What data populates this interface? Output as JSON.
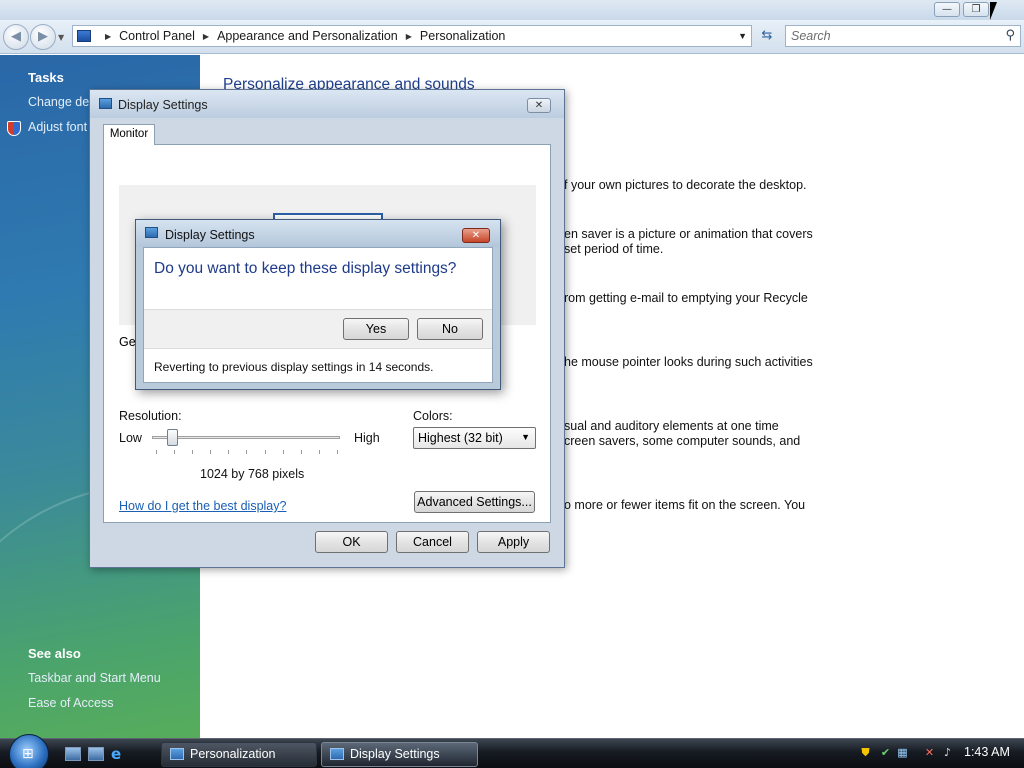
{
  "explorer": {
    "breadcrumb": [
      "Control Panel",
      "Appearance and Personalization",
      "Personalization"
    ],
    "search_placeholder": "Search",
    "back_icon": "back-arrow-icon",
    "forward_icon": "forward-arrow-icon"
  },
  "left_pane": {
    "tasks_heading": "Tasks",
    "task_links": [
      "Change des",
      "Adjust font"
    ],
    "see_also_heading": "See also",
    "see_also_links": [
      "Taskbar and Start Menu",
      "Ease of Access"
    ]
  },
  "content": {
    "title": "Personalize appearance and sounds",
    "lines": [
      "f your own pictures to decorate the desktop.",
      "en saver is a picture or animation that covers",
      "set period of time.",
      "rom getting e-mail to emptying your Recycle",
      "he mouse pointer looks during such activities",
      "sual and auditory elements at one time",
      "creen savers, some computer sounds, and",
      "o more or fewer items fit on the screen. You"
    ]
  },
  "display_dialog": {
    "title": "Display Settings",
    "tab": "Monitor",
    "general_text": "Ger",
    "resolution_label": "Resolution:",
    "low_label": "Low",
    "high_label": "High",
    "resolution_value": "1024 by 768 pixels",
    "slider_fraction": 0.11,
    "colors_label": "Colors:",
    "colors_value": "Highest (32 bit)",
    "help_link": "How do I get the best display?",
    "advanced_button": "Advanced Settings...",
    "ok_button": "OK",
    "cancel_button": "Cancel",
    "apply_button": "Apply"
  },
  "confirm_dialog": {
    "title": "Display Settings",
    "question": "Do you want to keep these display settings?",
    "yes_button": "Yes",
    "no_button": "No",
    "countdown_text": "Reverting to previous display settings in 14 seconds."
  },
  "taskbar": {
    "tasks": [
      "Personalization",
      "Display Settings"
    ],
    "clock": "1:43 AM"
  }
}
